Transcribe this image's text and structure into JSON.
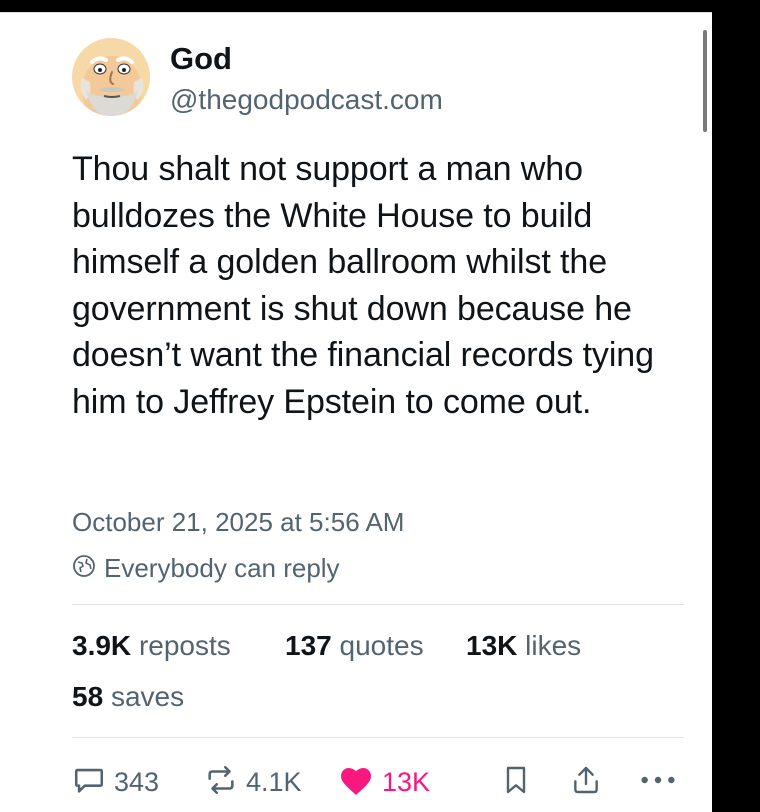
{
  "post": {
    "author_name": "God",
    "author_handle": "@thegodpodcast.com",
    "text": "Thou shalt not support a man who bulldozes the White House to build himself a golden ballroom whilst the government is shut down because he doesn’t want the financial records tying him to Jeffrey Epstein to come out.",
    "timestamp": "October 21, 2025 at 5:56 AM",
    "reply_setting": "Everybody can reply"
  },
  "stats": {
    "reposts_count": "3.9K",
    "reposts_label": "reposts",
    "quotes_count": "137",
    "quotes_label": "quotes",
    "likes_count": "13K",
    "likes_label": "likes",
    "saves_count": "58",
    "saves_label": "saves"
  },
  "actions": {
    "reply_count": "343",
    "repost_count": "4.1K",
    "like_count": "13K"
  },
  "colors": {
    "text_primary": "#0f1419",
    "text_secondary": "#536471",
    "like_active": "#f91880",
    "avatar_bg": "#f6d9a6"
  },
  "icons": {
    "avatar": "cartoon-god-face-avatar",
    "reply_setting": "globe-icon",
    "reply": "speech-bubble-icon",
    "repost": "repost-arrows-icon",
    "like": "heart-icon",
    "bookmark": "bookmark-icon",
    "share": "share-upload-icon",
    "more": "more-dots-icon"
  }
}
